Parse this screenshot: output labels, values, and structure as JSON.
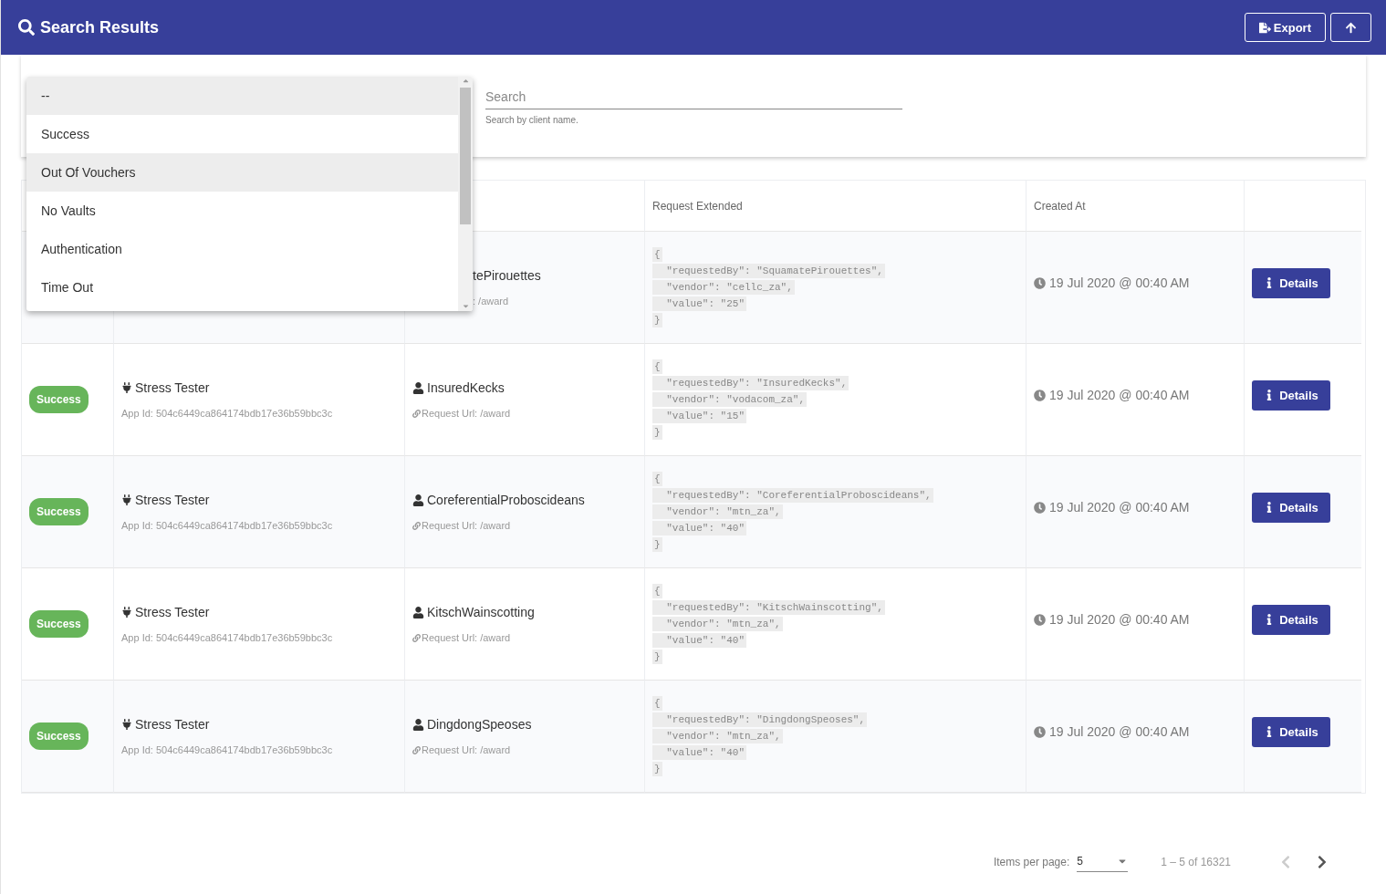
{
  "header": {
    "title": "Search Results",
    "buttons": [
      {
        "kind": "export",
        "label": "Export"
      },
      {
        "kind": "up"
      }
    ]
  },
  "filters": {
    "search": {
      "placeholder": "Search",
      "hint": "Search by client name."
    }
  },
  "dropdown": {
    "items": [
      {
        "label": "--",
        "highlighted": true
      },
      {
        "label": "Success",
        "highlighted": false
      },
      {
        "label": "Out Of Vouchers",
        "highlighted": true
      },
      {
        "label": "No Vaults",
        "highlighted": false
      },
      {
        "label": "Authentication",
        "highlighted": false
      },
      {
        "label": "Time Out",
        "highlighted": false
      }
    ]
  },
  "table": {
    "columns": [
      {
        "label": "Request Extended"
      },
      {
        "label": "Created At"
      }
    ],
    "rows": [
      {
        "covered": true,
        "client": "tePirouettes",
        "request_url": ": /award",
        "json": [
          "{",
          "  \"requestedBy\": \"SquamatePirouettes\",",
          "  \"vendor\": \"cellc_za\",",
          "  \"value\": \"25\"",
          "}"
        ],
        "created": "19 Jul 2020 @ 00:40 AM",
        "action": "Details"
      },
      {
        "covered": false,
        "status": "Success",
        "app": "Stress Tester",
        "app_id": "App Id: 504c6449ca864174bdb17e36b59bbc3c",
        "client": "InsuredKecks",
        "request_url": "Request Url: /award",
        "json": [
          "{",
          "  \"requestedBy\": \"InsuredKecks\",",
          "  \"vendor\": \"vodacom_za\",",
          "  \"value\": \"15\"",
          "}"
        ],
        "created": "19 Jul 2020 @ 00:40 AM",
        "action": "Details"
      },
      {
        "covered": false,
        "status": "Success",
        "app": "Stress Tester",
        "app_id": "App Id: 504c6449ca864174bdb17e36b59bbc3c",
        "client": "CoreferentialProboscideans",
        "request_url": "Request Url: /award",
        "json": [
          "{",
          "  \"requestedBy\": \"CoreferentialProboscideans\",",
          "  \"vendor\": \"mtn_za\",",
          "  \"value\": \"40\"",
          "}"
        ],
        "created": "19 Jul 2020 @ 00:40 AM",
        "action": "Details"
      },
      {
        "covered": false,
        "status": "Success",
        "app": "Stress Tester",
        "app_id": "App Id: 504c6449ca864174bdb17e36b59bbc3c",
        "client": "KitschWainscotting",
        "request_url": "Request Url: /award",
        "json": [
          "{",
          "  \"requestedBy\": \"KitschWainscotting\",",
          "  \"vendor\": \"mtn_za\",",
          "  \"value\": \"40\"",
          "}"
        ],
        "created": "19 Jul 2020 @ 00:40 AM",
        "action": "Details"
      },
      {
        "covered": false,
        "status": "Success",
        "app": "Stress Tester",
        "app_id": "App Id: 504c6449ca864174bdb17e36b59bbc3c",
        "client": "DingdongSpeoses",
        "request_url": "Request Url: /award",
        "json": [
          "{",
          "  \"requestedBy\": \"DingdongSpeoses\",",
          "  \"vendor\": \"mtn_za\",",
          "  \"value\": \"40\"",
          "}"
        ],
        "created": "19 Jul 2020 @ 00:40 AM",
        "action": "Details"
      }
    ]
  },
  "pagination": {
    "items_per_page_label": "Items per page:",
    "page_size": "5",
    "range": "1 – 5 of 16321",
    "previous_disabled": true,
    "next_disabled": false
  }
}
